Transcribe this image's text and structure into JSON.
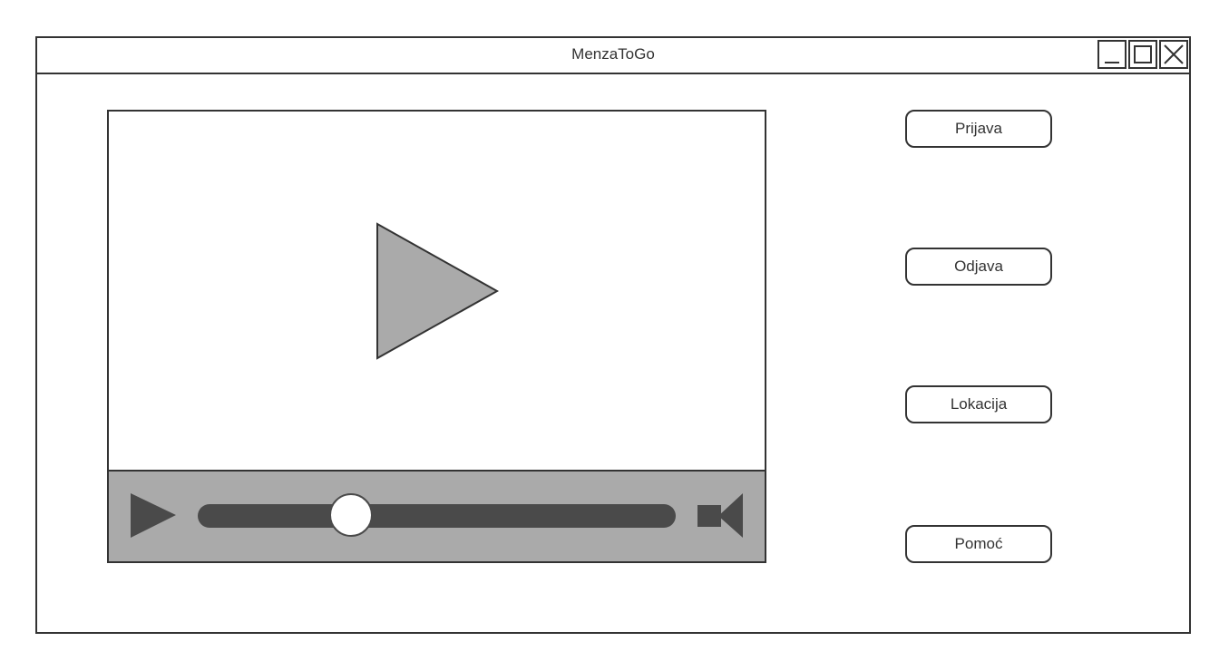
{
  "window": {
    "title": "MenzaToGo",
    "controls": {
      "minimize_icon": "minimize-icon",
      "maximize_icon": "maximize-icon",
      "close_icon": "close-icon"
    }
  },
  "video_player": {
    "big_play_icon": "play-icon",
    "control_play_icon": "play-icon",
    "volume_icon": "speaker-icon",
    "seek_progress": 0.32
  },
  "navigation": {
    "buttons": [
      {
        "label": "Prijava"
      },
      {
        "label": "Odjava"
      },
      {
        "label": "Lokacija"
      },
      {
        "label": "Pomoć"
      }
    ]
  },
  "colors": {
    "border": "#333333",
    "control_bar": "#aaaaaa",
    "track": "#4a4a4a",
    "play_fill": "#aaaaaa"
  }
}
